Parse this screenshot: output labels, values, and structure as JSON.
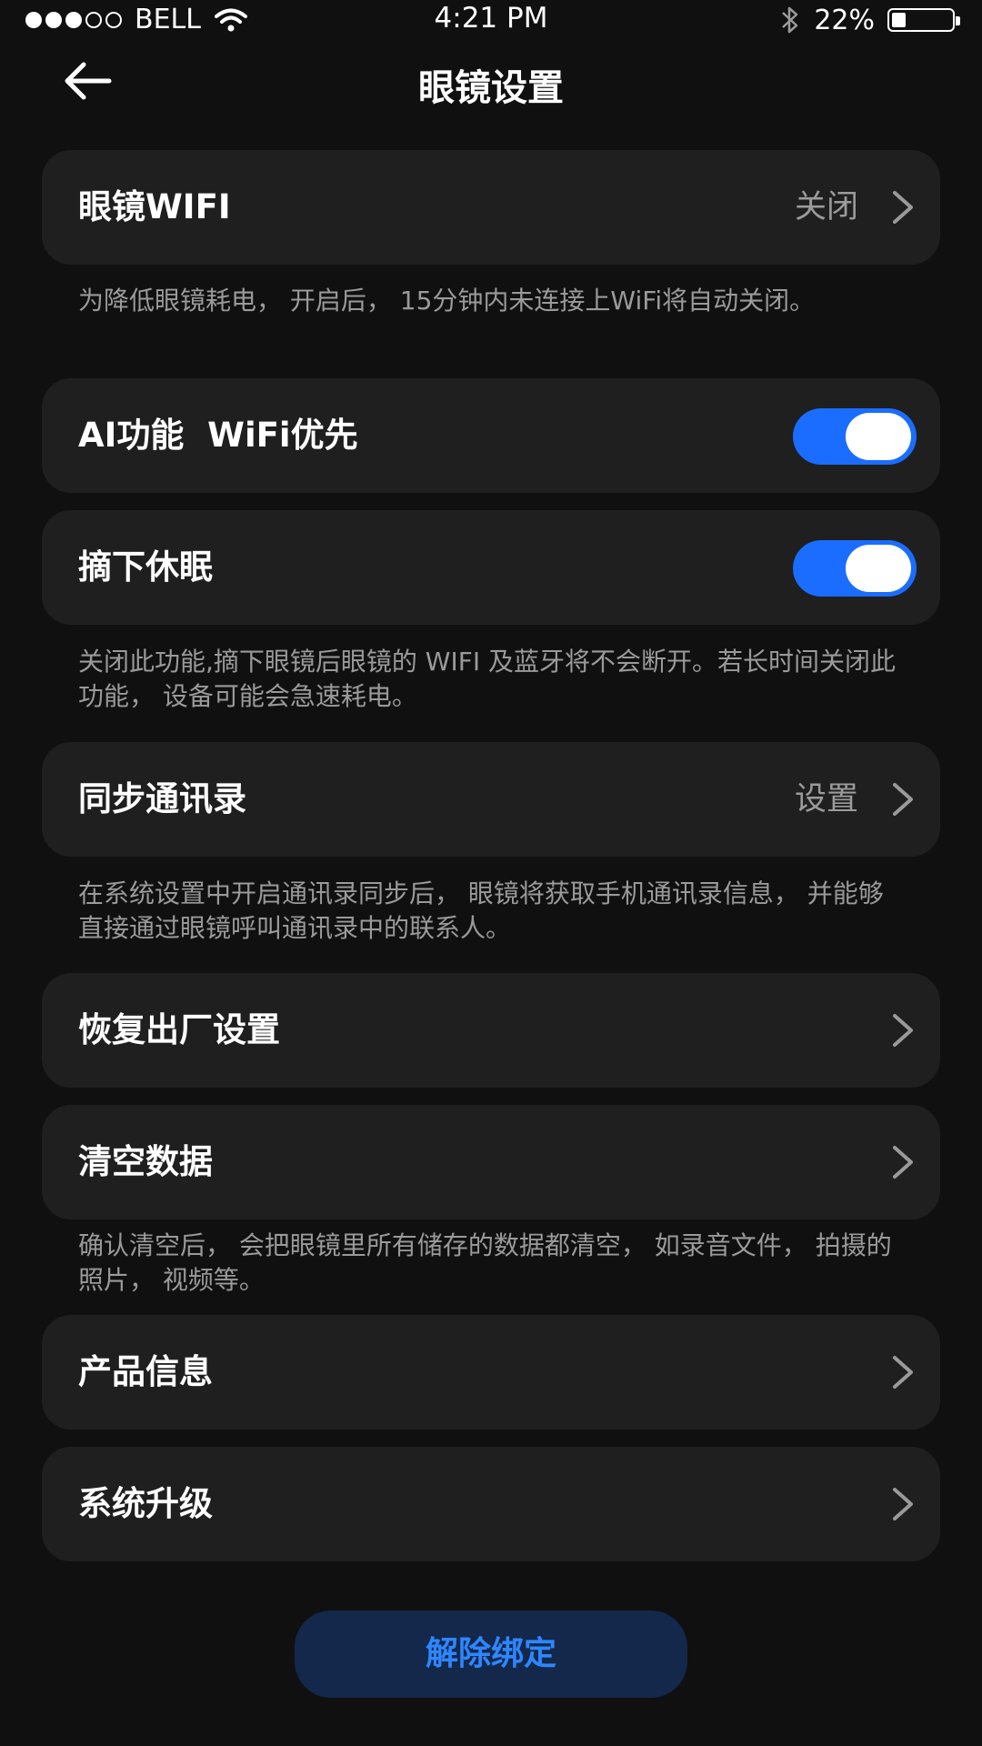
{
  "status_bar": {
    "carrier": "BELL",
    "time": "4:21 PM",
    "battery_percent": "22%",
    "battery_level": 0.22,
    "signal_bars_filled": 3,
    "signal_bars_total": 5,
    "icons": [
      "wifi-icon",
      "bluetooth-icon",
      "battery-icon"
    ]
  },
  "header": {
    "title": "眼镜设置",
    "back_icon": "back-arrow-icon"
  },
  "settings": {
    "glasses_wifi": {
      "label": "眼镜WIFI",
      "value": "关闭"
    },
    "glasses_wifi_desc": "为降低眼镜耗电， 开启后， 15分钟内未连接上WiFi将自动关闭。",
    "ai_wifi_first": {
      "label": "AI功能  WiFi优先",
      "enabled": true
    },
    "sleep_on_remove": {
      "label": "摘下休眠",
      "enabled": true
    },
    "sleep_desc": "关闭此功能,摘下眼镜后眼镜的 WIFI 及蓝牙将不会断开。若长时间关闭此功能， 设备可能会急速耗电。",
    "sync_contacts": {
      "label": "同步通讯录",
      "value": "设置"
    },
    "sync_desc": "在系统设置中开启通讯录同步后， 眼镜将获取手机通讯录信息， 并能够直接通过眼镜呼叫通讯录中的联系人。",
    "factory_reset": {
      "label": "恢复出厂设置"
    },
    "clear_data": {
      "label": "清空数据"
    },
    "clear_desc": "确认清空后， 会把眼镜里所有储存的数据都清空， 如录音文件， 拍摄的照片， 视频等。",
    "product_info": {
      "label": "产品信息"
    },
    "system_upgrade": {
      "label": "系统升级"
    }
  },
  "unbind_button": {
    "label": "解除绑定"
  },
  "colors": {
    "background": "#101010",
    "card": "#1f1f1f",
    "accent": "#1a6dff",
    "unbind_bg": "#13284a",
    "unbind_text": "#2e86ff",
    "secondary_text": "#9a9a9a"
  }
}
